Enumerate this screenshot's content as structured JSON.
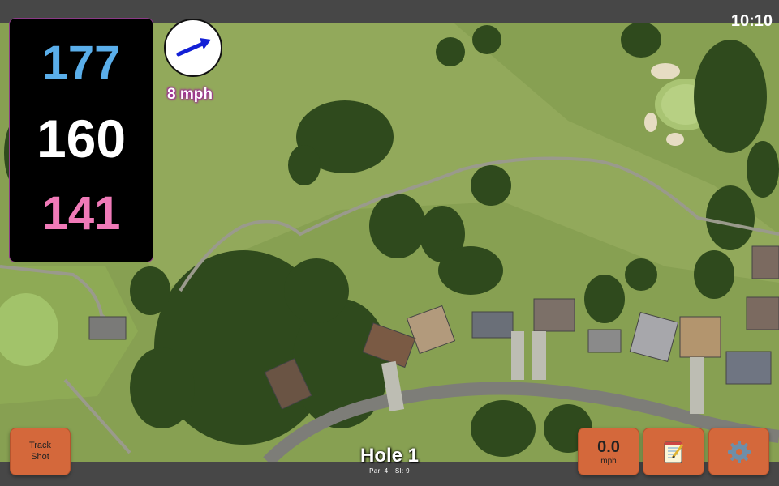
{
  "status": {
    "time": "10:10"
  },
  "distances": {
    "back": "177",
    "middle": "160",
    "front": "141"
  },
  "wind": {
    "speed_label": "8 mph",
    "icon": "wind-arrow-icon"
  },
  "hole": {
    "title": "Hole 1",
    "par": "Par: 4",
    "si": "SI: 9"
  },
  "buttons": {
    "track_line1": "Track",
    "track_line2": "Shot",
    "speed_value": "0.0",
    "speed_unit": "mph",
    "notes_icon": "notepad-icon",
    "settings_icon": "gear-icon"
  },
  "colors": {
    "back": "#5aaeea",
    "middle": "#ffffff",
    "front": "#f07ab8",
    "button": "#d4683b",
    "wind_label_glow": "#a0229a"
  }
}
